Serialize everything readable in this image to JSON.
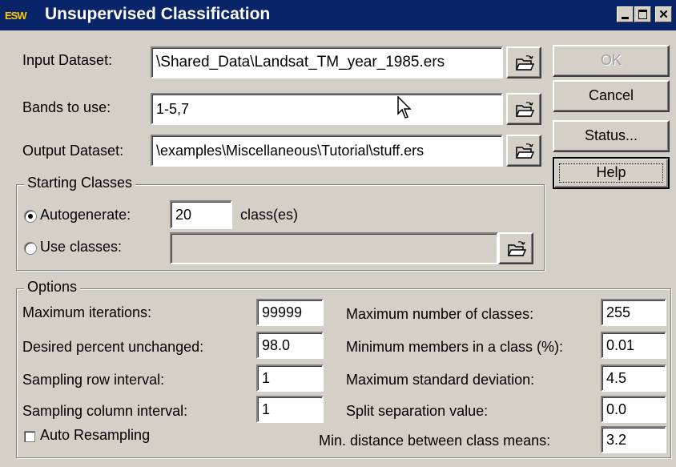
{
  "window": {
    "title": "Unsupervised Classification",
    "icon_text": "ESW",
    "title_buttons": [
      "minimize-icon",
      "maximize-icon",
      "close-icon"
    ]
  },
  "input_dataset": {
    "label": "Input Dataset:",
    "value": "\\Shared_Data\\Landsat_TM_year_1985.ers"
  },
  "bands": {
    "label": "Bands to use:",
    "value": "1-5,7"
  },
  "output_dataset": {
    "label": "Output Dataset:",
    "value": "\\examples\\Miscellaneous\\Tutorial\\stuff.ers"
  },
  "buttons": {
    "ok": {
      "label": "OK",
      "enabled": false
    },
    "cancel": "Cancel",
    "status": "Status...",
    "help": "Help"
  },
  "starting_classes": {
    "title": "Starting Classes",
    "autogenerate_label": "Autogenerate:",
    "autogenerate_value": "20",
    "autogenerate_selected": true,
    "units": "class(es)",
    "use_classes_label": "Use classes:",
    "use_classes_value": ""
  },
  "options": {
    "title": "Options",
    "max_iterations": {
      "label": "Maximum iterations:",
      "value": "99999"
    },
    "desired_percent": {
      "label": "Desired percent unchanged:",
      "value": "98.0"
    },
    "row_interval": {
      "label": "Sampling row interval:",
      "value": "1"
    },
    "column_interval": {
      "label": "Sampling column interval:",
      "value": "1"
    },
    "auto_resampling": {
      "label": "Auto Resampling",
      "checked": false
    },
    "max_classes": {
      "label": "Maximum number of classes:",
      "value": "255"
    },
    "min_members": {
      "label": "Minimum members in a class (%):",
      "value": "0.01"
    },
    "max_std_dev": {
      "label": "Maximum standard deviation:",
      "value": "4.5"
    },
    "split_separation": {
      "label": "Split separation value:",
      "value": "0.0"
    },
    "min_distance": {
      "label": "Min. distance between class means:",
      "value": "3.2"
    }
  },
  "icons": {
    "browse": "open-folder-icon",
    "cursor": "mouse-pointer-icon"
  }
}
